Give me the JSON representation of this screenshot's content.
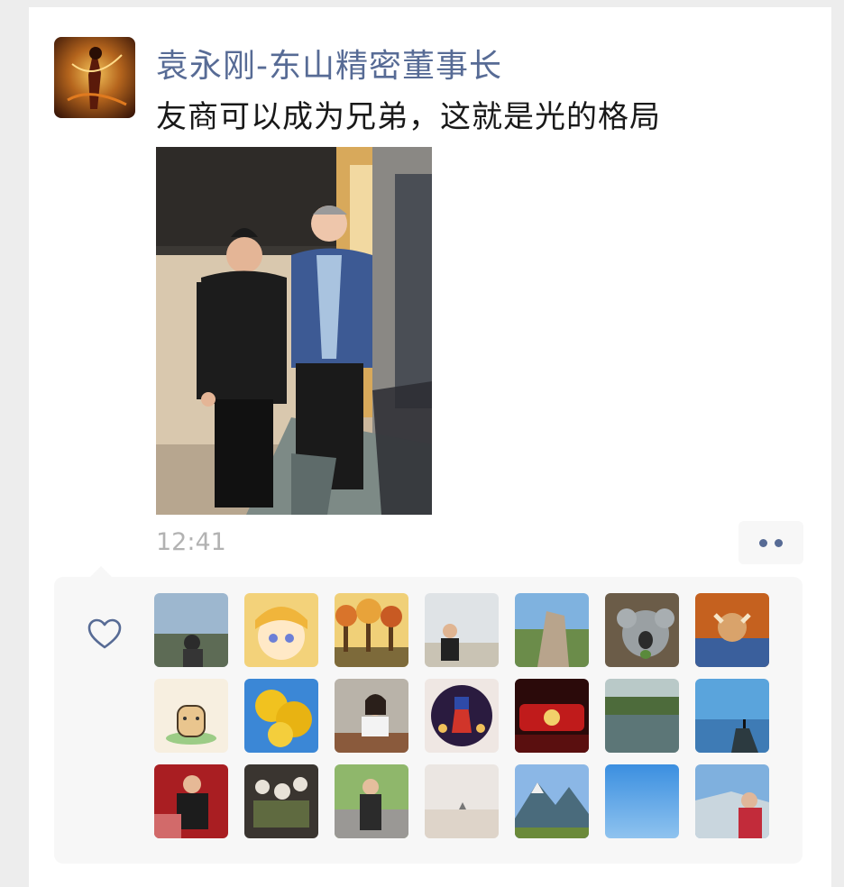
{
  "post": {
    "author": "袁永刚-东山精密董事长",
    "text": "友商可以成为兄弟，这就是光的格局",
    "time": "12:41"
  },
  "icons": {
    "avatar": "author-avatar",
    "photo": "post-photo",
    "more": "more-dots-icon",
    "like": "heart-icon"
  },
  "colors": {
    "name": "#576b95",
    "text": "#191919",
    "time": "#b2b2b2",
    "panel": "#f7f7f7"
  },
  "likes": {
    "avatars": [
      "liker-avatar-1",
      "liker-avatar-2",
      "liker-avatar-3",
      "liker-avatar-4",
      "liker-avatar-5",
      "liker-avatar-6",
      "liker-avatar-7",
      "liker-avatar-8",
      "liker-avatar-9",
      "liker-avatar-10",
      "liker-avatar-11",
      "liker-avatar-12",
      "liker-avatar-13",
      "liker-avatar-14",
      "liker-avatar-15",
      "liker-avatar-16",
      "liker-avatar-17",
      "liker-avatar-18",
      "liker-avatar-19",
      "liker-avatar-20",
      "liker-avatar-21"
    ]
  }
}
